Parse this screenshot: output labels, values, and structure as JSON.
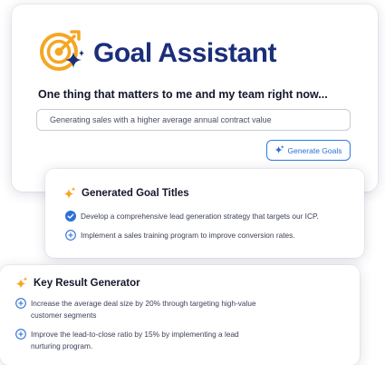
{
  "app": {
    "title": "Goal Assistant",
    "prompt_label": "One thing that matters to me and my team right now...",
    "input_value": "Generating sales with a higher average annual contract value",
    "generate_button_label": "Generate Goals",
    "logo_icon": "target-sparkle-logo"
  },
  "goals": {
    "title": "Generated Goal Titles",
    "items": [
      {
        "label": "Develop a comprehensive lead generation strategy that targets our ICP.",
        "icon": "check-circle-icon",
        "selected": true
      },
      {
        "label": "Implement a sales training program to improve conversion rates.",
        "icon": "plus-circle-icon",
        "selected": false
      }
    ]
  },
  "key_results": {
    "title": "Key Result Generator",
    "items": [
      {
        "line1": "Increase the average deal size by 20% through targeting high-value",
        "line2": "customer segments",
        "icon": "plus-circle-icon"
      },
      {
        "line1": "Improve the lead-to-close ratio by 15% by implementing a lead",
        "line2": "nurturing program.",
        "icon": "plus-circle-icon"
      }
    ]
  },
  "colors": {
    "brand_navy": "#1b2e7a",
    "accent_blue": "#2d7be0",
    "sparkle_orange": "#f5a623"
  }
}
